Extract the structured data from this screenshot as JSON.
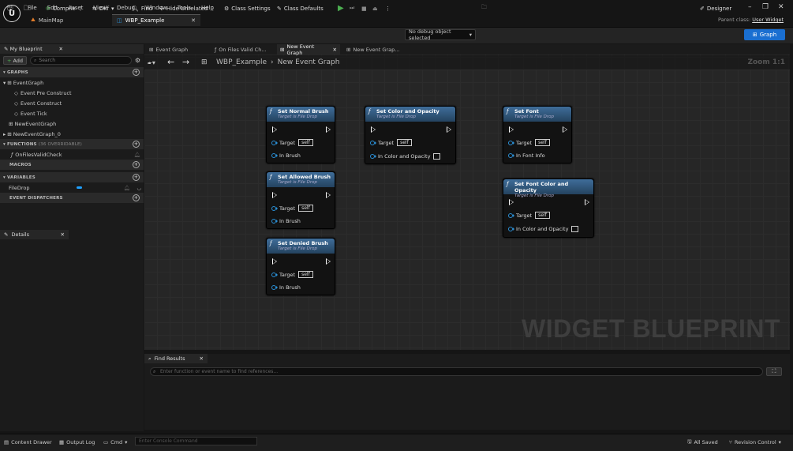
{
  "menu": [
    "File",
    "Edit",
    "Asset",
    "View",
    "Debug",
    "Window",
    "Tools",
    "Help"
  ],
  "doc_tabs": [
    {
      "label": "MainMap"
    },
    {
      "label": "WBP_Example"
    }
  ],
  "parent_class": {
    "label": "Parent class:",
    "value": "User Widget"
  },
  "toolbar": {
    "compile": "Compile",
    "diff": "Diff",
    "find": "Find",
    "hide_unrelated": "Hide Unrelated",
    "class_settings": "Class Settings",
    "class_defaults": "Class Defaults",
    "debug_object": "No debug object selected",
    "designer": "Designer",
    "graph": "Graph"
  },
  "left_panel": {
    "tab": "My Blueprint",
    "add": "Add",
    "search_placeholder": "Search",
    "graphs_header": "GRAPHS",
    "graphs": [
      "EventGraph",
      "Event Pre Construct",
      "Event Construct",
      "Event Tick",
      "NewEventGraph",
      "NewEventGraph_0"
    ],
    "functions_header": "FUNCTIONS",
    "functions_overridable": "(36 OVERRIDABLE)",
    "functions": [
      "OnFilesValidCheck"
    ],
    "macros_header": "MACROS",
    "variables_header": "VARIABLES",
    "variables": [
      "FileDrop"
    ],
    "dispatchers_header": "EVENT DISPATCHERS",
    "details_tab": "Details"
  },
  "graph": {
    "tabs": [
      "Event Graph",
      "On Files Valid Ch...",
      "New Event Graph",
      "New Event Grap..."
    ],
    "breadcrumb_root": "WBP_Example",
    "breadcrumb_current": "New Event Graph",
    "zoom": "Zoom 1:1",
    "watermark": "WIDGET BLUEPRINT",
    "target_label": "Target",
    "self_label": "self",
    "nodes": [
      {
        "title": "Set Normal Brush",
        "subtitle": "Target is File Drop",
        "pin": "In Brush"
      },
      {
        "title": "Set Allowed Brush",
        "subtitle": "Target is File Drop",
        "pin": "In Brush"
      },
      {
        "title": "Set Denied Brush",
        "subtitle": "Target is File Drop",
        "pin": "In Brush"
      },
      {
        "title": "Set Color and Opacity",
        "subtitle": "Target is File Drop",
        "pin": "In Color and Opacity"
      },
      {
        "title": "Set Font",
        "subtitle": "Target is File Drop",
        "pin": "In Font Info"
      },
      {
        "title": "Set Font Color and Opacity",
        "subtitle": "Target is File Drop",
        "pin": "In Color and Opacity"
      }
    ]
  },
  "find_results": {
    "tab": "Find Results",
    "placeholder": "Enter function or event name to find references..."
  },
  "status_bar": {
    "content_drawer": "Content Drawer",
    "output_log": "Output Log",
    "cmd": "Cmd",
    "console_placeholder": "Enter Console Command",
    "all_saved": "All Saved",
    "revision_control": "Revision Control"
  },
  "colors": {
    "accent": "#1a6fd1",
    "node_header": "#3f6d9a",
    "pin": "#2a8fd6",
    "variable_type": "#1ea0ff"
  }
}
